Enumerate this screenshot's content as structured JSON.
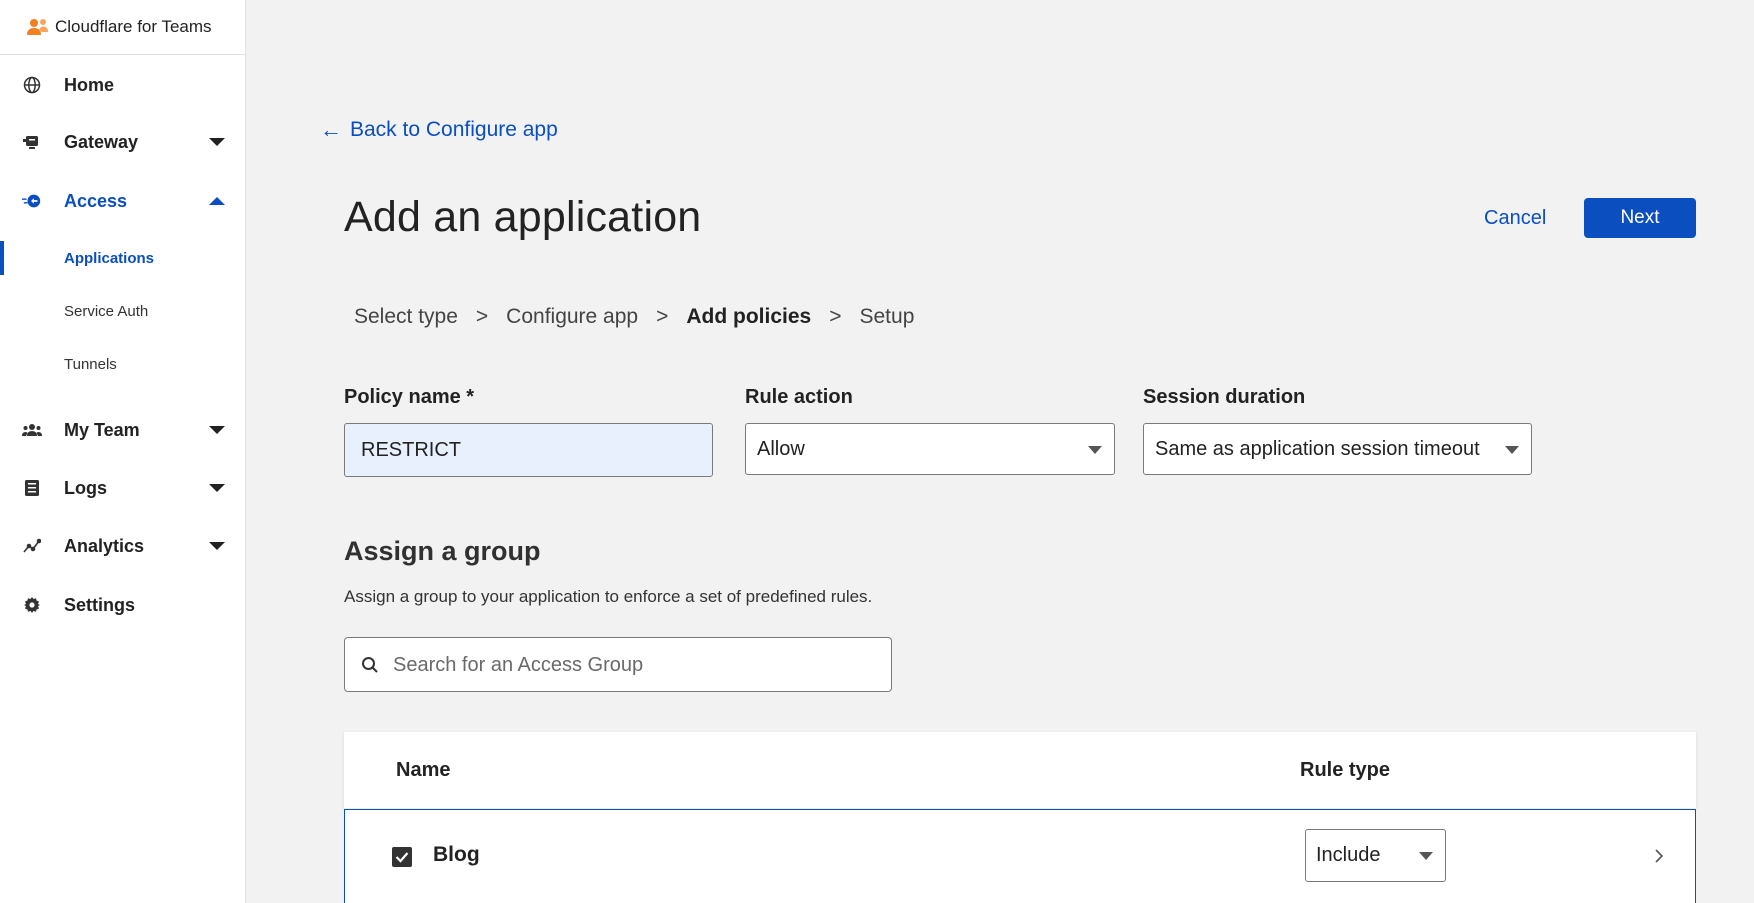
{
  "brand": {
    "name": "Cloudflare for Teams"
  },
  "sidebar": {
    "items": [
      {
        "label": "Home",
        "icon": "globe-icon"
      },
      {
        "label": "Gateway",
        "icon": "gateway-icon",
        "caret": "down"
      },
      {
        "label": "Access",
        "icon": "access-icon",
        "caret": "up",
        "active": true
      },
      {
        "label": "My Team",
        "icon": "team-icon",
        "caret": "down"
      },
      {
        "label": "Logs",
        "icon": "logs-icon",
        "caret": "down"
      },
      {
        "label": "Analytics",
        "icon": "analytics-icon",
        "caret": "down"
      },
      {
        "label": "Settings",
        "icon": "gear-icon"
      }
    ],
    "access_sub": [
      {
        "label": "Applications",
        "active": true
      },
      {
        "label": "Service Auth"
      },
      {
        "label": "Tunnels"
      }
    ]
  },
  "main": {
    "back_link": "Back to Configure app",
    "title": "Add an application",
    "cancel_label": "Cancel",
    "next_label": "Next",
    "steps": [
      "Select type",
      "Configure app",
      "Add policies",
      "Setup"
    ],
    "step_separator": ">",
    "current_step": "Add policies",
    "policy_name_label": "Policy name *",
    "policy_name_value": "RESTRICT",
    "rule_action_label": "Rule action",
    "rule_action_value": "Allow",
    "session_duration_label": "Session duration",
    "session_duration_value": "Same as application session timeout",
    "assign_title": "Assign a group",
    "assign_desc": "Assign a group to your application to enforce a set of predefined rules.",
    "search_placeholder": "Search for an Access Group",
    "table": {
      "columns": [
        "Name",
        "Rule type"
      ],
      "rows": [
        {
          "name": "Blog",
          "checked": true,
          "rule_type": "Include"
        }
      ]
    }
  },
  "colors": {
    "accent": "#0a4ebf",
    "brand_orange": "#f38020",
    "background": "#f2f2f2",
    "input_highlight": "#e8f0fe"
  }
}
